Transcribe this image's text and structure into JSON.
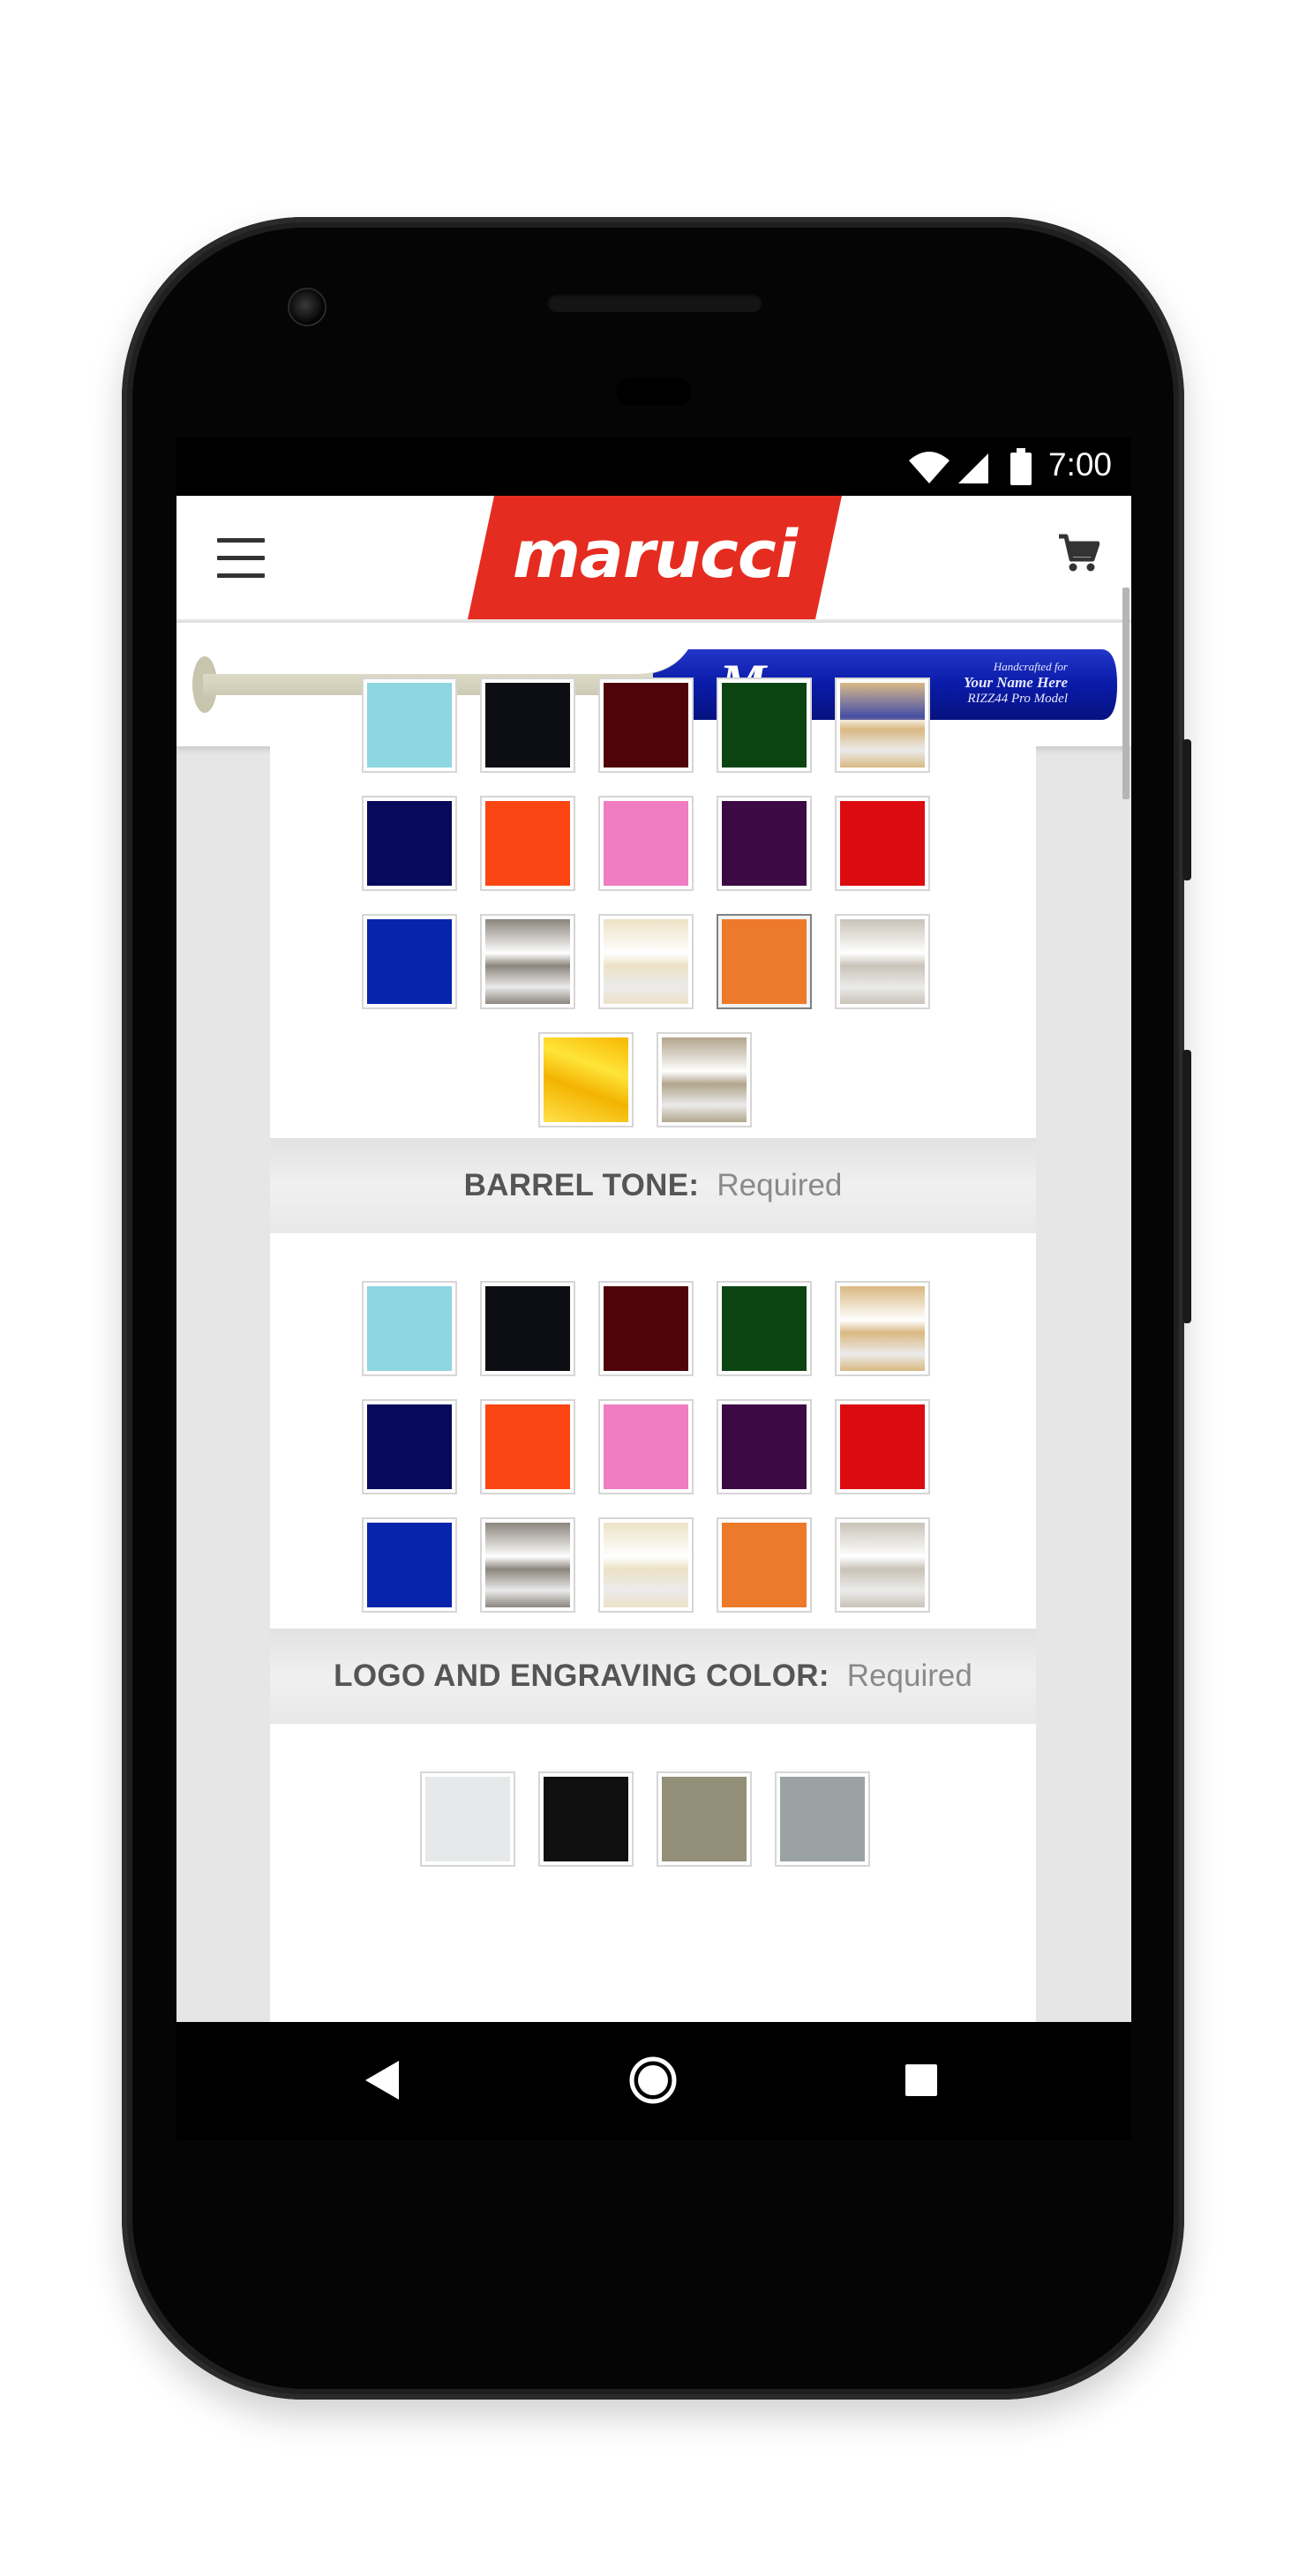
{
  "status_bar": {
    "time": "7:00"
  },
  "header": {
    "brand": "marucci",
    "brand_color": "#e52c20"
  },
  "bat_preview": {
    "engraving_line1": "Handcrafted for",
    "engraving_line2": "Your Name Here",
    "engraving_line3": "RIZZ44 Pro Model",
    "logo_text": "marucci",
    "barrel_color": "#0a1ba8",
    "handle_color": "#d9d6c2"
  },
  "sections": {
    "barrel_tone": {
      "label": "BARREL TONE:",
      "requirement": "Required"
    },
    "logo_engraving": {
      "label": "LOGO AND ENGRAVING COLOR:",
      "requirement": "Required"
    }
  },
  "swatch_palette": [
    "light-blue",
    "black",
    "maroon",
    "green",
    "natural",
    "navy",
    "orange",
    "pink",
    "purple",
    "red",
    "royal-blue",
    "gray-wood",
    "cream-wood",
    "burnt-orange",
    "silver-wood",
    "gold",
    "natural-grain"
  ],
  "swatch_colors": {
    "light-blue": "#8dd6e2",
    "black": "#0d0d14",
    "maroon": "#4e0408",
    "green": "#0c4411",
    "natural": "#d9b882",
    "navy": "#070a5c",
    "orange": "#fb4512",
    "pink": "#f07cc2",
    "purple": "#3d0944",
    "red": "#dc0b10",
    "royal-blue": "#0724ad",
    "gray-wood": "#8b857d",
    "cream-wood": "#ece2c6",
    "burnt-orange": "#ed7a2a",
    "silver-wood": "#c9c3b8",
    "gold": "#ffd60a",
    "natural-grain": "#b1a58c"
  },
  "upper_grid_selected": "burnt-orange",
  "logo_color_swatches": [
    "white",
    "black",
    "khaki",
    "gray"
  ],
  "logo_color_values": {
    "white": "#e6e8ea",
    "black": "#101010",
    "khaki": "#938f78",
    "gray": "#9aa2a4"
  },
  "nav": {
    "back": "back-icon",
    "home": "home-icon",
    "recents": "recents-icon"
  }
}
